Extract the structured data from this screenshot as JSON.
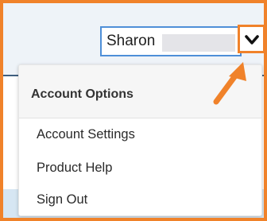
{
  "header": {
    "user_name": "Sharon",
    "dropdown_icon": "chevron-down-icon"
  },
  "account_menu": {
    "title": "Account Options",
    "items": [
      {
        "label": "Account Settings"
      },
      {
        "label": "Product Help"
      },
      {
        "label": "Sign Out"
      }
    ]
  },
  "annotation": {
    "icon": "arrow-icon",
    "color": "#f0822a"
  }
}
